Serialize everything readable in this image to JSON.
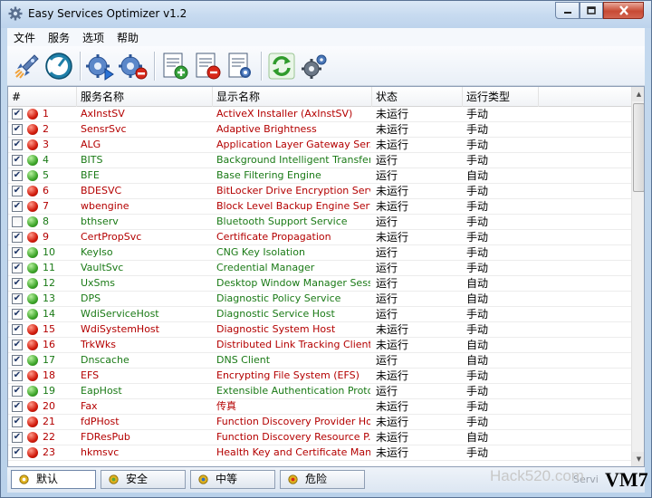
{
  "window": {
    "title": "Easy Services Optimizer v1.2"
  },
  "menu": [
    "文件",
    "服务",
    "选项",
    "帮助"
  ],
  "columns": [
    "#",
    "服务名称",
    "显示名称",
    "状态",
    "运行类型"
  ],
  "rows": [
    {
      "checked": true,
      "status_color": "red",
      "num": "1",
      "name": "AxInstSV",
      "display": "ActiveX Installer (AxInstSV)",
      "state": "未运行",
      "type": "手动"
    },
    {
      "checked": true,
      "status_color": "red",
      "num": "2",
      "name": "SensrSvc",
      "display": "Adaptive Brightness",
      "state": "未运行",
      "type": "手动"
    },
    {
      "checked": true,
      "status_color": "red",
      "num": "3",
      "name": "ALG",
      "display": "Application Layer Gateway Ser...",
      "state": "未运行",
      "type": "手动"
    },
    {
      "checked": true,
      "status_color": "green",
      "num": "4",
      "name": "BITS",
      "display": "Background Intelligent Transfer...",
      "state": "运行",
      "type": "手动"
    },
    {
      "checked": true,
      "status_color": "green",
      "num": "5",
      "name": "BFE",
      "display": "Base Filtering Engine",
      "state": "运行",
      "type": "自动"
    },
    {
      "checked": true,
      "status_color": "red",
      "num": "6",
      "name": "BDESVC",
      "display": "BitLocker Drive Encryption Service",
      "state": "未运行",
      "type": "手动"
    },
    {
      "checked": true,
      "status_color": "red",
      "num": "7",
      "name": "wbengine",
      "display": "Block Level Backup Engine Service",
      "state": "未运行",
      "type": "手动"
    },
    {
      "checked": false,
      "status_color": "green",
      "num": "8",
      "name": "bthserv",
      "display": "Bluetooth Support Service",
      "state": "运行",
      "type": "手动"
    },
    {
      "checked": true,
      "status_color": "red",
      "num": "9",
      "name": "CertPropSvc",
      "display": "Certificate Propagation",
      "state": "未运行",
      "type": "手动"
    },
    {
      "checked": true,
      "status_color": "green",
      "num": "10",
      "name": "KeyIso",
      "display": "CNG Key Isolation",
      "state": "运行",
      "type": "手动"
    },
    {
      "checked": true,
      "status_color": "green",
      "num": "11",
      "name": "VaultSvc",
      "display": "Credential Manager",
      "state": "运行",
      "type": "手动"
    },
    {
      "checked": true,
      "status_color": "green",
      "num": "12",
      "name": "UxSms",
      "display": "Desktop Window Manager Sess...",
      "state": "运行",
      "type": "自动"
    },
    {
      "checked": true,
      "status_color": "green",
      "num": "13",
      "name": "DPS",
      "display": "Diagnostic Policy Service",
      "state": "运行",
      "type": "自动"
    },
    {
      "checked": true,
      "status_color": "green",
      "num": "14",
      "name": "WdiServiceHost",
      "display": "Diagnostic Service Host",
      "state": "运行",
      "type": "手动"
    },
    {
      "checked": true,
      "status_color": "red",
      "num": "15",
      "name": "WdiSystemHost",
      "display": "Diagnostic System Host",
      "state": "未运行",
      "type": "手动"
    },
    {
      "checked": true,
      "status_color": "red",
      "num": "16",
      "name": "TrkWks",
      "display": "Distributed Link Tracking Client",
      "state": "未运行",
      "type": "自动"
    },
    {
      "checked": true,
      "status_color": "green",
      "num": "17",
      "name": "Dnscache",
      "display": "DNS Client",
      "state": "运行",
      "type": "自动"
    },
    {
      "checked": true,
      "status_color": "red",
      "num": "18",
      "name": "EFS",
      "display": "Encrypting File System (EFS)",
      "state": "未运行",
      "type": "手动"
    },
    {
      "checked": true,
      "status_color": "green",
      "num": "19",
      "name": "EapHost",
      "display": "Extensible Authentication Proto...",
      "state": "运行",
      "type": "手动"
    },
    {
      "checked": true,
      "status_color": "red",
      "num": "20",
      "name": "Fax",
      "display": "传真",
      "state": "未运行",
      "type": "手动"
    },
    {
      "checked": true,
      "status_color": "red",
      "num": "21",
      "name": "fdPHost",
      "display": "Function Discovery Provider Host",
      "state": "未运行",
      "type": "手动"
    },
    {
      "checked": true,
      "status_color": "red",
      "num": "22",
      "name": "FDResPub",
      "display": "Function Discovery Resource P...",
      "state": "未运行",
      "type": "自动"
    },
    {
      "checked": true,
      "status_color": "red",
      "num": "23",
      "name": "hkmsvc",
      "display": "Health Key and Certificate Man...",
      "state": "未运行",
      "type": "手动"
    }
  ],
  "bottom_tabs": [
    "默认",
    "安全",
    "中等",
    "危险"
  ],
  "status_text": "Servi",
  "watermark": "Hack520.com",
  "corner_logo": "VM7",
  "colors": {
    "red": "#b40000",
    "green": "#1a7a16"
  }
}
